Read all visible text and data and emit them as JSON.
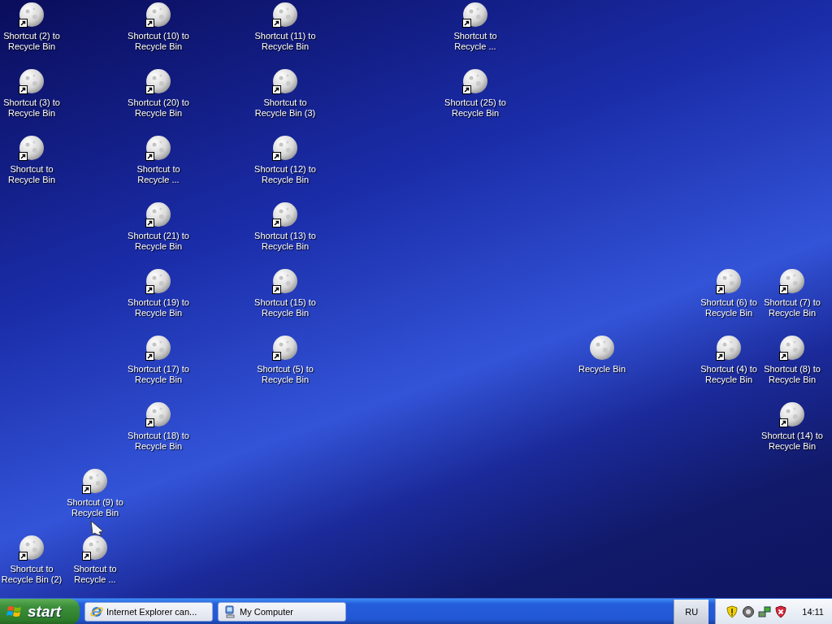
{
  "desktop_icons": [
    {
      "label": "Shortcut (2) to Recycle Bin",
      "shortcut": true
    },
    {
      "label": "Shortcut (10) to Recycle Bin",
      "shortcut": true
    },
    {
      "label": "Shortcut (11) to Recycle Bin",
      "shortcut": true
    },
    {
      "label": "Shortcut to Recycle ...",
      "shortcut": true
    },
    {
      "label": "Shortcut (3) to Recycle Bin",
      "shortcut": true
    },
    {
      "label": "Shortcut (20) to Recycle Bin",
      "shortcut": true
    },
    {
      "label": "Shortcut to Recycle Bin (3)",
      "shortcut": true
    },
    {
      "label": "Shortcut (25) to Recycle Bin",
      "shortcut": true
    },
    {
      "label": "Shortcut to Recycle Bin",
      "shortcut": true
    },
    {
      "label": "Shortcut to Recycle ...",
      "shortcut": true
    },
    {
      "label": "Shortcut (12) to Recycle Bin",
      "shortcut": true
    },
    {
      "label": "Shortcut (21) to Recycle Bin",
      "shortcut": true
    },
    {
      "label": "Shortcut (13) to Recycle Bin",
      "shortcut": true
    },
    {
      "label": "Shortcut (19) to Recycle Bin",
      "shortcut": true
    },
    {
      "label": "Shortcut (15) to Recycle Bin",
      "shortcut": true
    },
    {
      "label": "Shortcut (6) to Recycle Bin",
      "shortcut": true
    },
    {
      "label": "Shortcut (7) to Recycle Bin",
      "shortcut": true
    },
    {
      "label": "Shortcut (17) to Recycle Bin",
      "shortcut": true
    },
    {
      "label": "Shortcut (5) to Recycle Bin",
      "shortcut": true
    },
    {
      "label": "Recycle Bin",
      "shortcut": false
    },
    {
      "label": "Shortcut (4) to Recycle Bin",
      "shortcut": true
    },
    {
      "label": "Shortcut (8) to Recycle Bin",
      "shortcut": true
    },
    {
      "label": "Shortcut (18) to Recycle Bin",
      "shortcut": true
    },
    {
      "label": "Shortcut (14) to Recycle Bin",
      "shortcut": true
    },
    {
      "label": "Shortcut (9) to Recycle Bin",
      "shortcut": true
    },
    {
      "label": "Shortcut to Recycle Bin (2)",
      "shortcut": true
    },
    {
      "label": "Shortcut to Recycle ...",
      "shortcut": true
    }
  ],
  "taskbar": {
    "start_label": "start",
    "tasks": [
      {
        "kind": "browser",
        "label": "Internet Explorer can..."
      },
      {
        "kind": "computer",
        "label": "My Computer"
      }
    ],
    "language": "RU",
    "clock": "14:11"
  }
}
